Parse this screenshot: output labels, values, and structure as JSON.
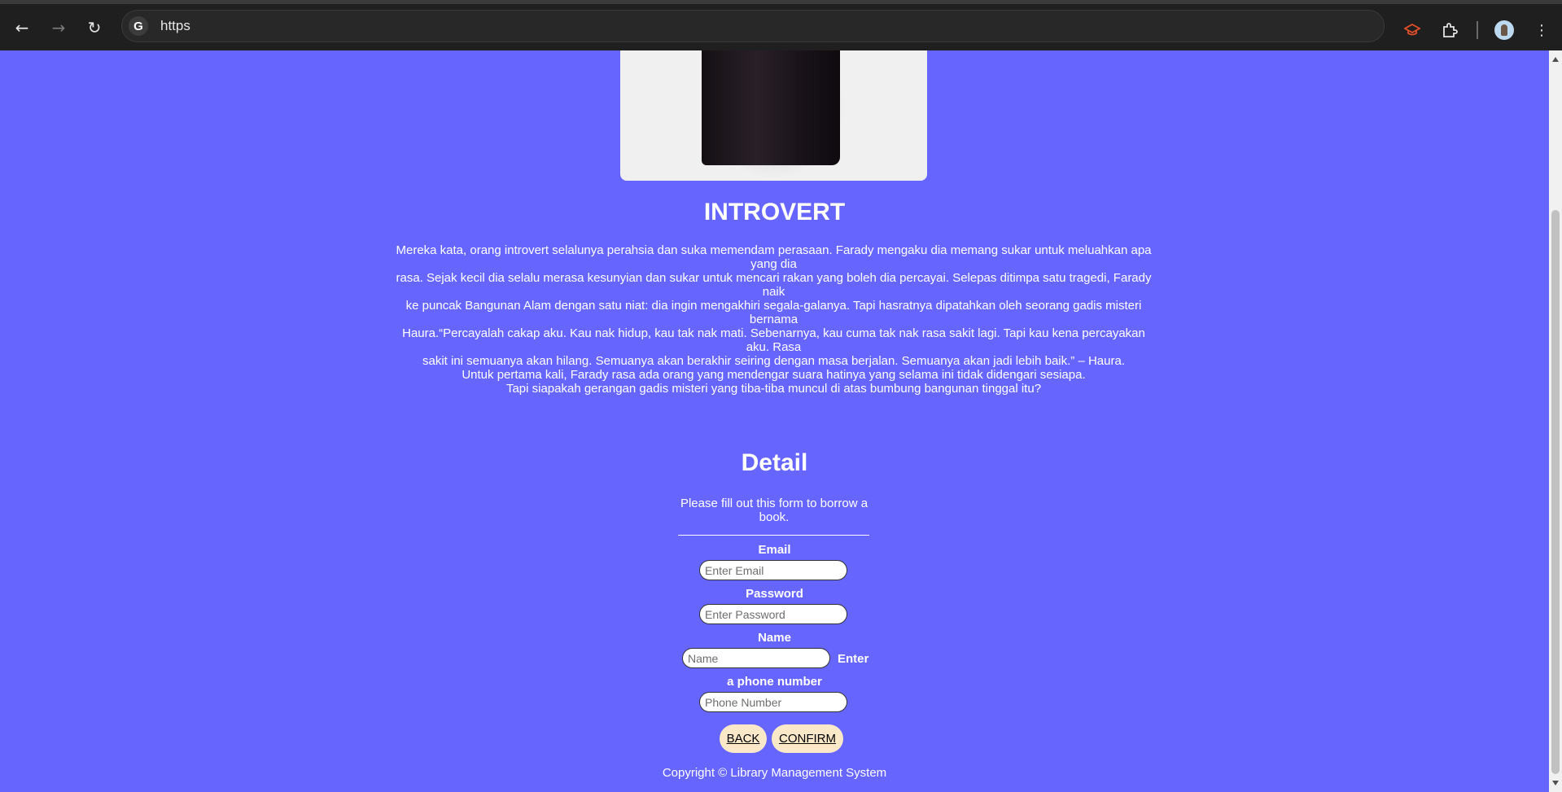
{
  "browser": {
    "back_icon": "arrow-back-icon",
    "forward_icon": "arrow-forward-icon",
    "reload_icon": "reload-icon",
    "url": "https",
    "site_icon": "google-g-icon",
    "site_icon_letter": "G"
  },
  "book": {
    "cover_image": "book-cover-image",
    "title": "INTROVERT",
    "synopsis_lines": [
      "Mereka kata, orang introvert selalunya perahsia dan suka memendam perasaan. Farady mengaku dia memang sukar untuk meluahkan apa yang dia",
      "rasa. Sejak kecil dia selalu merasa kesunyian dan sukar untuk mencari rakan yang boleh dia percayai. Selepas ditimpa satu tragedi, Farady naik",
      "ke puncak Bangunan Alam dengan satu niat: dia ingin mengakhiri segala-galanya. Tapi hasratnya dipatahkan oleh seorang gadis misteri bernama",
      "Haura.“Percayalah cakap aku. Kau nak hidup, kau tak nak mati. Sebenarnya, kau cuma tak nak rasa sakit lagi. Tapi kau kena percayakan aku. Rasa",
      "sakit ini semuanya akan hilang. Semuanya akan berakhir seiring dengan masa berjalan. Semuanya akan jadi lebih baik.” – Haura.",
      "Untuk pertama kali, Farady rasa ada orang yang mendengar suara hatinya yang selama ini tidak didengari sesiapa.",
      "Tapi siapakah gerangan gadis misteri yang tiba-tiba muncul di atas bumbung bangunan tinggal itu?"
    ]
  },
  "form": {
    "title": "Detail",
    "instructions": "Please fill out this form to borrow a book.",
    "email_label": "Email",
    "email_placeholder": "Enter Email",
    "password_label": "Password",
    "password_placeholder": "Enter Password",
    "name_label": "Name",
    "name_placeholder": "Name",
    "phone_label_part1": "Enter",
    "phone_label_part2": "a phone number",
    "phone_placeholder": "Phone Number",
    "back_button": "BACK",
    "confirm_button": "CONFIRM"
  },
  "footer": {
    "copyright": "Copyright © Library Management System"
  },
  "colors": {
    "page_background": "#6666ff",
    "button_background": "#fbe8c9",
    "chrome_background": "#1f1f1f"
  }
}
